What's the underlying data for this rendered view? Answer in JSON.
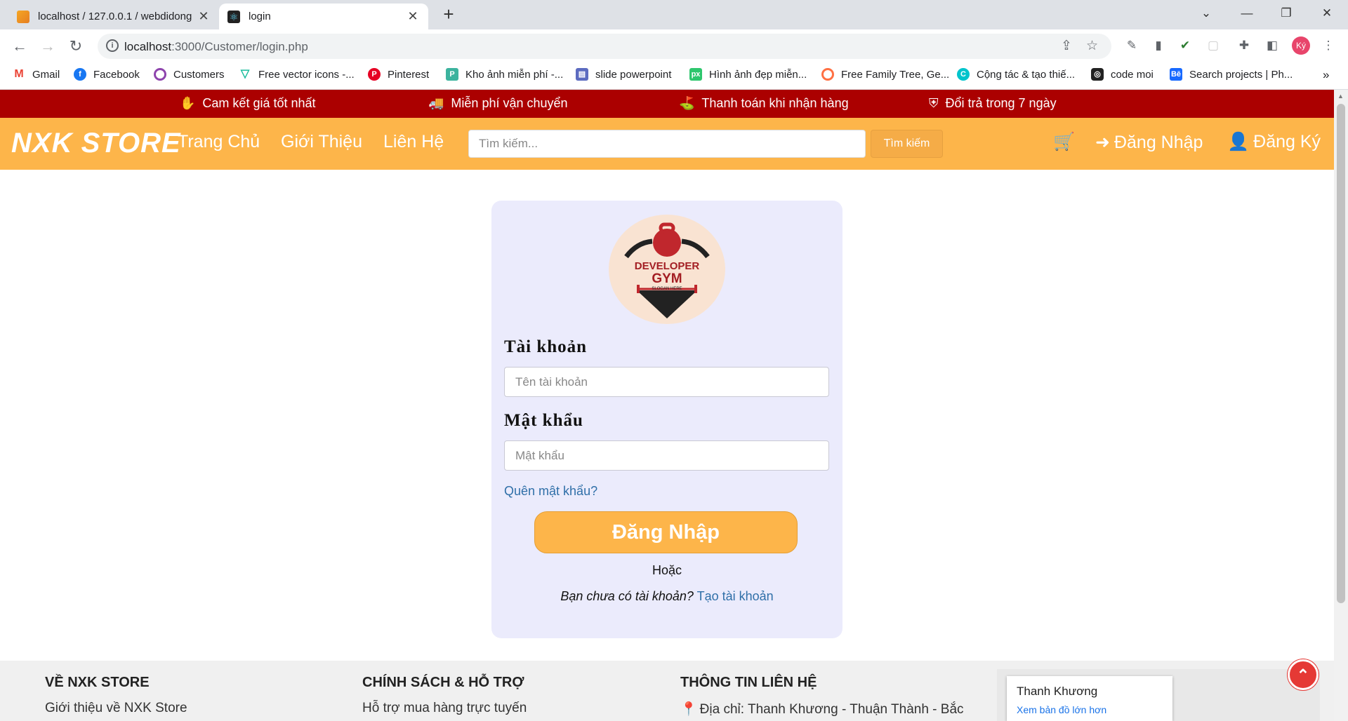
{
  "browser": {
    "tabs": [
      {
        "title": "localhost / 127.0.0.1 / webdidong",
        "close": "✕"
      },
      {
        "title": "login",
        "close": "✕"
      }
    ],
    "new_tab": "+",
    "url_host": "localhost",
    "url_path": ":3000/Customer/login.php",
    "bookmarks": [
      "Gmail",
      "Facebook",
      "Customers",
      "Free vector icons -...",
      "Pinterest",
      "Kho ảnh miễn phí -...",
      "slide powerpoint",
      "Hình ảnh đẹp miễn...",
      "Free Family Tree, Ge...",
      "Cộng tác & tạo thiế...",
      "code moi",
      "Search projects | Ph..."
    ],
    "bookmarks_more": "»",
    "profile_initials": "Ký"
  },
  "promo": {
    "items": [
      "Cam kết giá tốt nhất",
      "Miễn phí vận chuyển",
      "Thanh toán khi nhận hàng",
      "Đổi trả trong 7 ngày"
    ]
  },
  "header": {
    "logo": "NXK STORE",
    "nav": [
      "Trang Chủ",
      "Giới Thiệu",
      "Liên Hệ"
    ],
    "search_placeholder": "Tìm kiếm...",
    "search_button": "Tìm kiếm",
    "login": "Đăng Nhập",
    "register": "Đăng Ký"
  },
  "login_form": {
    "logo_line1": "DEVELOPER",
    "logo_line2": "GYM",
    "logo_slogan": "SLOGAN HERE",
    "username_label": "Tài khoản",
    "username_placeholder": "Tên tài khoản",
    "password_label": "Mật khẩu",
    "password_placeholder": "Mật khẩu",
    "forgot": "Quên mật khẩu?",
    "submit": "Đăng Nhập",
    "or": "Hoặc",
    "no_account": "Bạn chưa có tài khoản?",
    "create_account": "Tạo tài khoản"
  },
  "footer": {
    "col1_title": "VỀ NXK STORE",
    "col1_item": "Giới thiệu về NXK Store",
    "col2_title": "CHÍNH SÁCH & HỖ TRỢ",
    "col2_item": "Hỗ trợ mua hàng trực tuyến",
    "col3_title": "THÔNG TIN LIÊN HỆ",
    "col3_item": "Địa chỉ: Thanh Khương - Thuận Thành - Bắc",
    "map_place": "Thanh Khương",
    "map_link": "Xem bản đồ lớn hơn"
  },
  "colors": {
    "promo_bar": "#ab0000",
    "header": "#fdb54a",
    "card_bg": "#ebebfc",
    "link": "#2f6fa8",
    "scroll_top": "#e53935"
  }
}
